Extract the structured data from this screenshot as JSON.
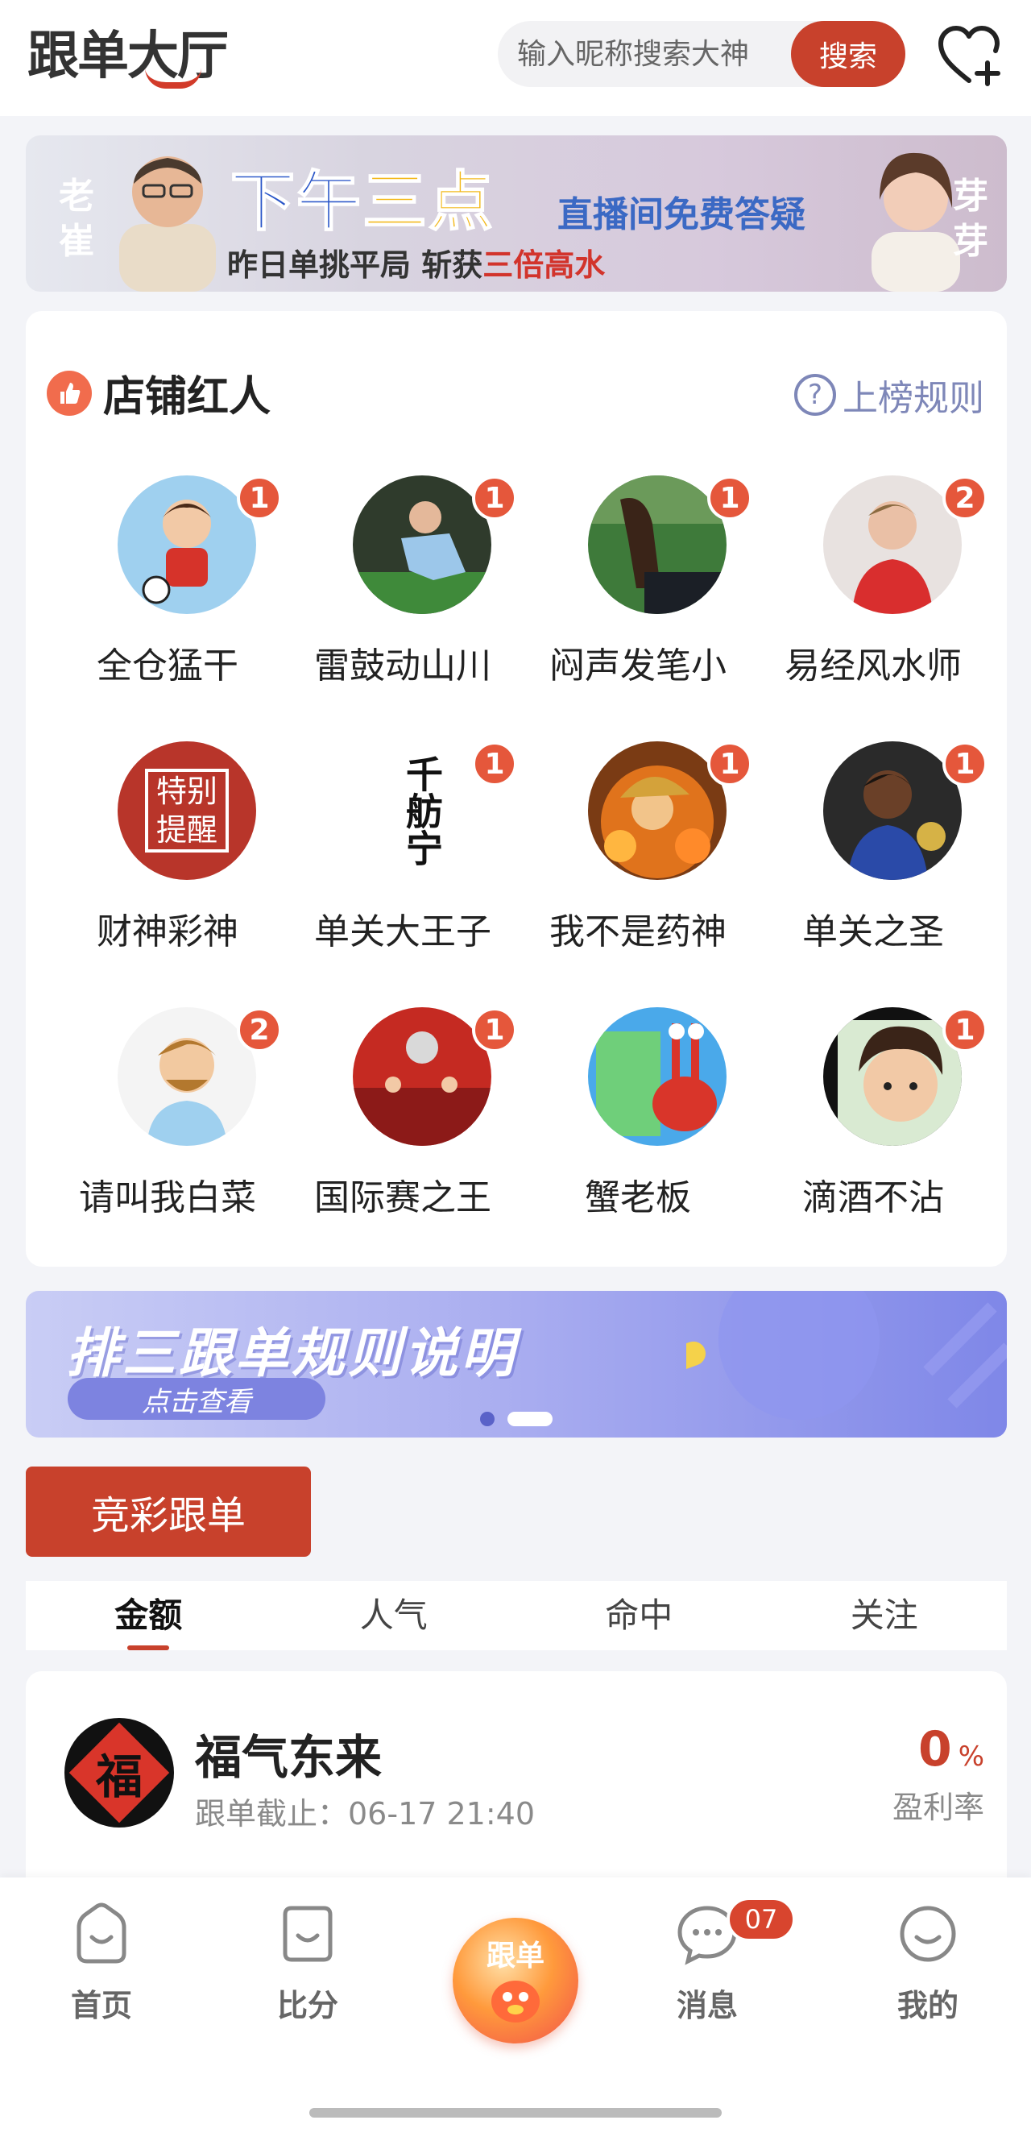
{
  "header": {
    "logo": "跟单大厅",
    "search_placeholder": "输入昵称搜索大神",
    "search_button": "搜索",
    "follow_icon": "heart-plus-icon"
  },
  "top_banner": {
    "left_name": "老崔",
    "right_name": "芽芽",
    "title_part1": "下午",
    "title_part2": "三点",
    "subtitle": "直播间免费答疑",
    "caption_pre": "昨日单挑平局 斩获",
    "caption_highlight": "三倍高水"
  },
  "influencers": {
    "title": "店铺红人",
    "rules_link": "上榜规则",
    "items": [
      {
        "name": "全仓猛干",
        "badge": "1"
      },
      {
        "name": "雷鼓动山川",
        "badge": "1"
      },
      {
        "name": "闷声发笔小",
        "badge": "1"
      },
      {
        "name": "易经风水师",
        "badge": "2"
      },
      {
        "name": "财神彩神",
        "badge": "",
        "avatar_text": "特别提醒"
      },
      {
        "name": "单关大王子",
        "badge": "1",
        "avatar_text": "千舫宁"
      },
      {
        "name": "我不是药神",
        "badge": "1"
      },
      {
        "name": "单关之圣",
        "badge": "1"
      },
      {
        "name": "请叫我白菜",
        "badge": "2"
      },
      {
        "name": "国际赛之王",
        "badge": "1"
      },
      {
        "name": "蟹老板",
        "badge": ""
      },
      {
        "name": "滴酒不沾",
        "badge": "1"
      }
    ]
  },
  "rules_banner": {
    "title": "排三跟单规则说明",
    "button": "点击查看"
  },
  "section_button": "竞彩跟单",
  "sort_tabs": [
    "金额",
    "人气",
    "命中",
    "关注"
  ],
  "list": [
    {
      "name": "福气东来",
      "avatar_text": "福",
      "deadline": "跟单截止：06-17 21:40",
      "rate": "0",
      "rate_unit": "%",
      "rate_label": "盈利率"
    }
  ],
  "bottom_nav": {
    "items": [
      {
        "label": "首页",
        "icon": "home-icon"
      },
      {
        "label": "比分",
        "icon": "score-icon"
      },
      {
        "label": "跟单",
        "icon": "follow-mascot-icon"
      },
      {
        "label": "消息",
        "icon": "message-icon",
        "badge": "07"
      },
      {
        "label": "我的",
        "icon": "profile-icon"
      }
    ]
  },
  "colors": {
    "accent": "#c8412c",
    "badge": "#e5573b",
    "link": "#7e87b8",
    "background": "#f3f4f8"
  }
}
